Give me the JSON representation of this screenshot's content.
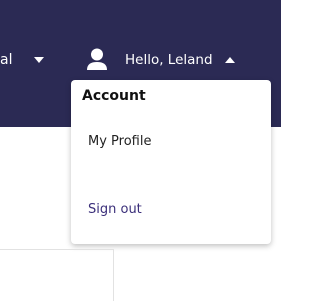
{
  "nav": {
    "left_item_label": "al",
    "user_greeting": "Hello, Leland"
  },
  "account_menu": {
    "heading": "Account",
    "items": [
      {
        "label": "My Profile"
      },
      {
        "label": "Sign out"
      }
    ]
  },
  "colors": {
    "navbar_bg": "#2b2a54",
    "signout_text": "#3b2f7a"
  }
}
